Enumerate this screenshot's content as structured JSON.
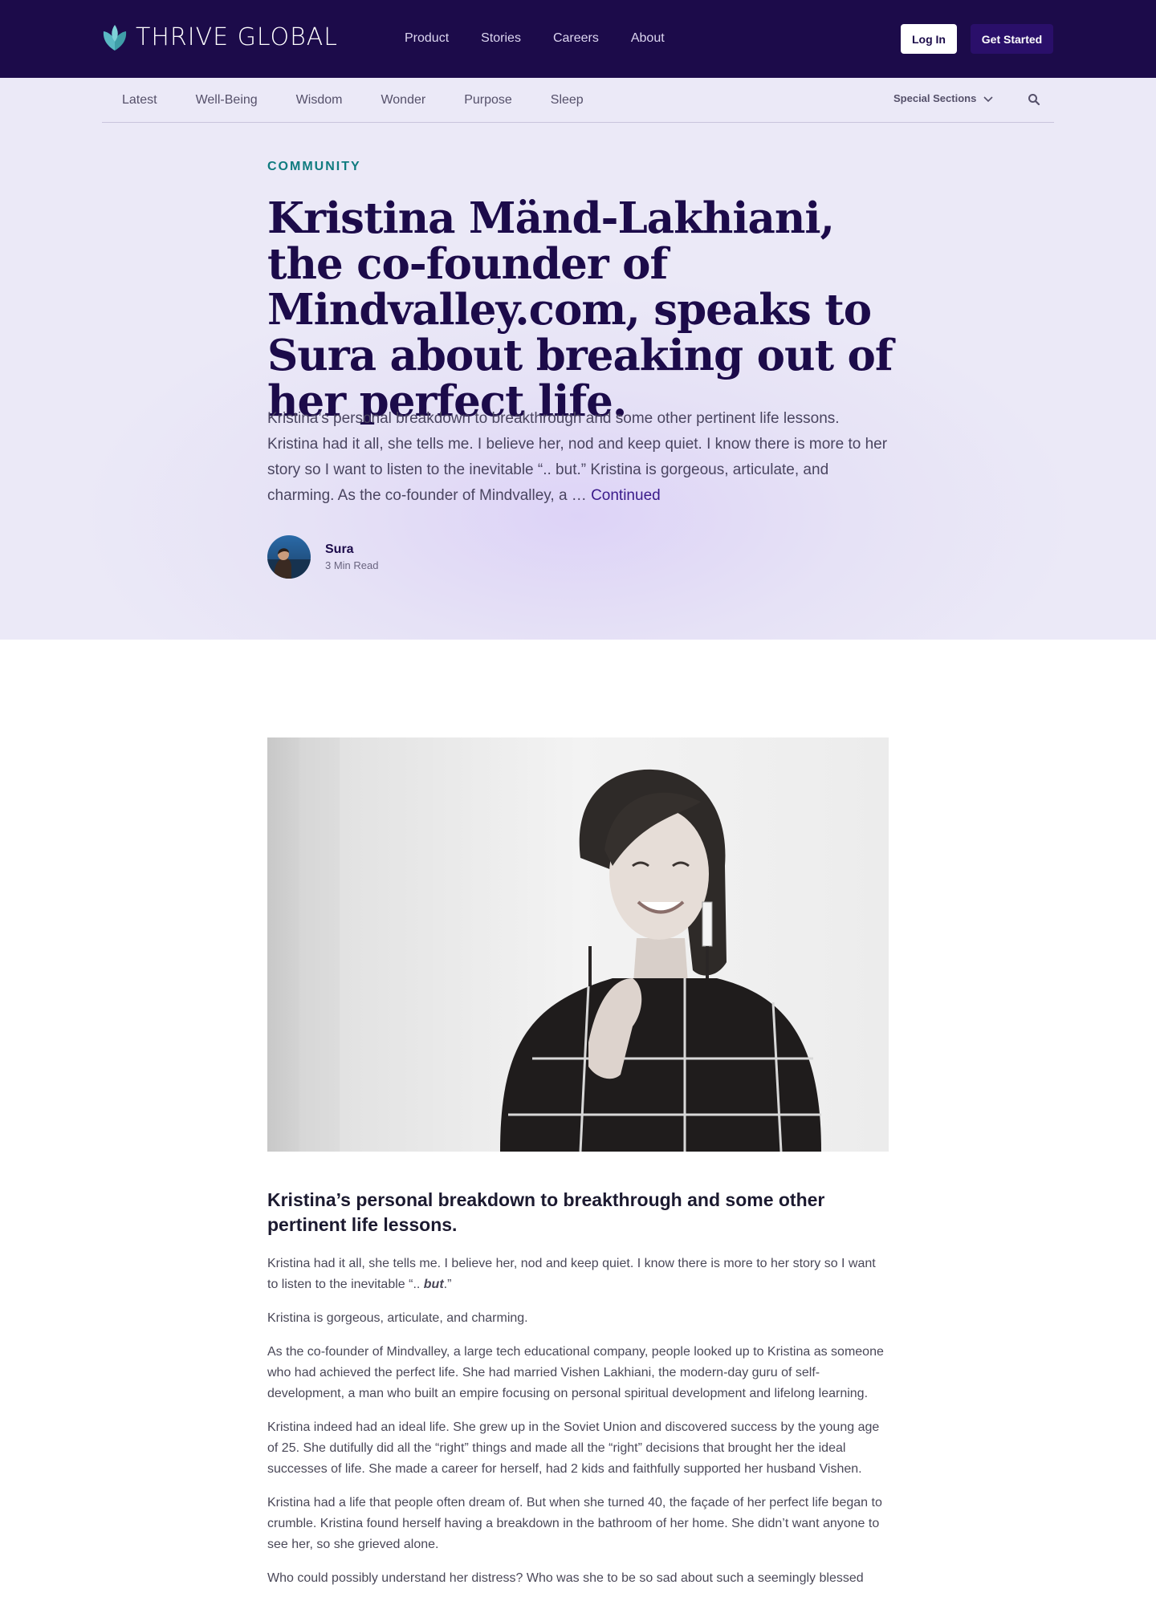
{
  "brand": {
    "name": "THRIVE GLOBAL"
  },
  "nav": {
    "items": [
      "Product",
      "Stories",
      "Careers",
      "About"
    ],
    "login_label": "Log In",
    "start_label": "Get Started"
  },
  "subnav": {
    "items": [
      "Latest",
      "Well-Being",
      "Wisdom",
      "Wonder",
      "Purpose",
      "Sleep"
    ],
    "special_label": "Special Sections"
  },
  "article": {
    "category": "COMMUNITY",
    "title": "Kristina Mänd-Lakhiani, the co-founder of Mindvalley.com, speaks to Sura about breaking out of her perfect life.",
    "summary": "Kristina’s personal breakdown to breakthrough and some other pertinent life lessons. Kristina had it all, she tells me. I believe her, nod and keep quiet. I know there is more to her story so I want to listen to the inevitable “.. but.” Kristina is gorgeous, articulate, and charming. As the co-founder of Mindvalley, a … ",
    "continued_label": "Continued",
    "author": "Sura",
    "read_time": "3 Min Read",
    "subheading": "Kristina’s personal breakdown to breakthrough and some other pertinent life lessons.",
    "p1_start": "Kristina had it all, she tells me. I believe her, nod and keep quiet. I know there is more to her story so I want to listen to the inevitable “.. ",
    "p1_emphasis": "but",
    "p1_end": ".”",
    "paragraphs": [
      "Kristina is gorgeous, articulate, and charming.",
      "As the co-founder of Mindvalley, a large tech educational company, people looked up to Kristina as someone who had achieved the perfect life. She had married Vishen Lakhiani, the modern-day guru of self-development, a man who built an empire focusing on personal spiritual development and lifelong learning.",
      "Kristina indeed had an ideal life. She grew up in the Soviet Union and discovered success by the young age of 25. She dutifully did all the “right” things and made all the “right” decisions that brought her the ideal successes of life. She made a career for herself, had 2 kids and faithfully supported her husband Vishen.",
      "Kristina had a life that people often dream of. But when she turned 40, the façade of her perfect life began to crumble. Kristina found herself having a breakdown in the bathroom of her home. She didn’t want anyone to see her, so she grieved alone.",
      "Who could possibly understand her distress? Who was she to be so sad about such a seemingly blessed"
    ]
  },
  "colors": {
    "nav_bg": "#1c0b4a",
    "accent_teal": "#0f7b7f",
    "headline": "#1c0b4a",
    "hero_bg": "#ebe9f7"
  },
  "icons": [
    "thrive-leaf-logo-icon",
    "chevron-down-icon",
    "search-icon"
  ]
}
